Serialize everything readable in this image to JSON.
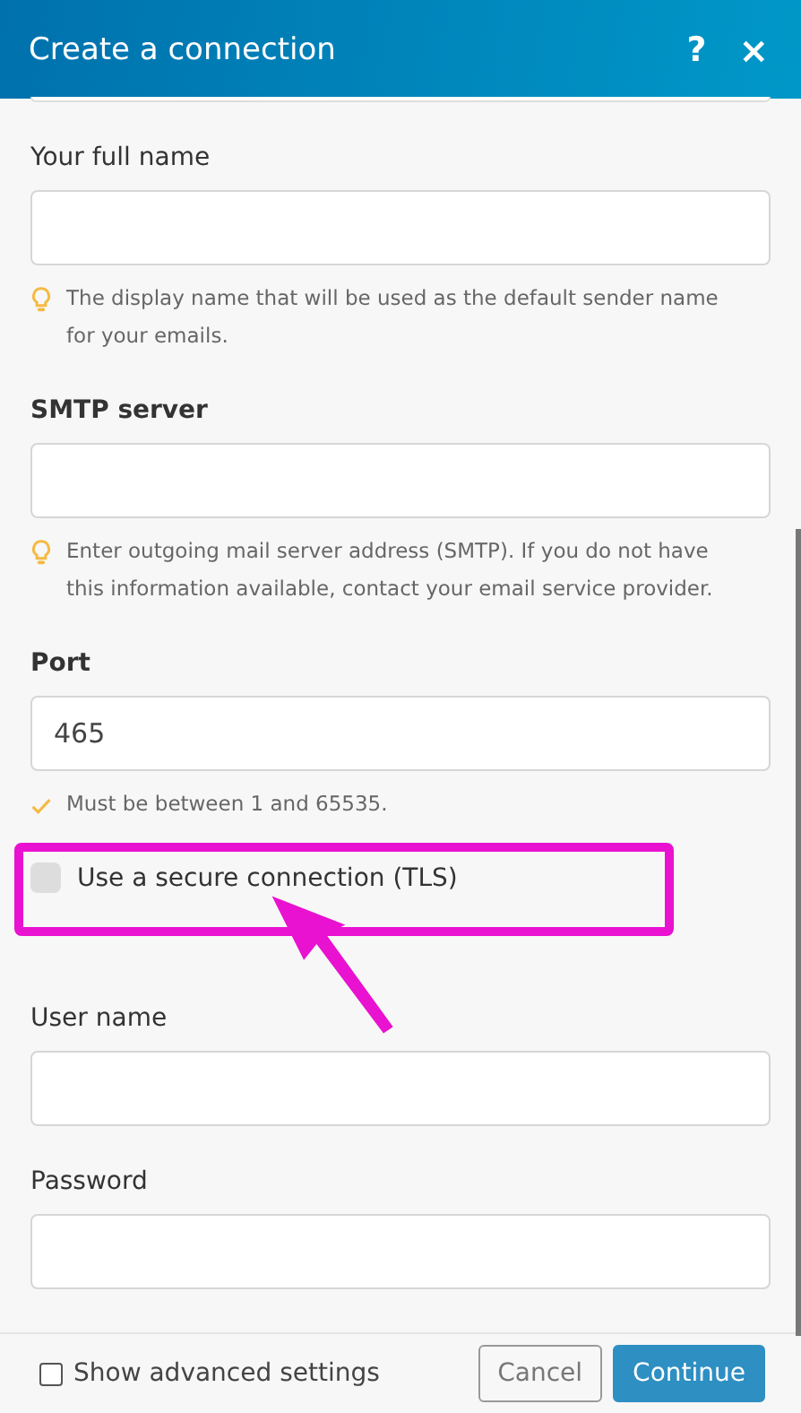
{
  "window": {
    "title": "Create a connection",
    "help": "?",
    "close": "×"
  },
  "fields": [
    {
      "kind": "text",
      "label": "Your full name",
      "required": false,
      "hint": {
        "kind": "tip",
        "text": "The display name that will be used as the default sender name for your emails."
      }
    },
    {
      "kind": "text",
      "label": "SMTP server",
      "required": true,
      "hint": {
        "kind": "tip",
        "text": "Enter outgoing mail server address (SMTP). If you do not have this information available, contact your email service provider."
      }
    },
    {
      "kind": "text",
      "label": "Port",
      "required": true,
      "value": "465",
      "hint": {
        "kind": "valid",
        "text": "Must be between 1 and 65535."
      }
    },
    {
      "kind": "checkbox",
      "label": "Use a secure connection (TLS)",
      "checked": false,
      "highlighted": true
    },
    {
      "kind": "text",
      "label": "User name",
      "required": false
    },
    {
      "kind": "password",
      "label": "Password",
      "required": false
    }
  ],
  "footer": {
    "advanced": {
      "label": "Show advanced settings",
      "checked": false
    },
    "buttons": [
      {
        "kind": "secondary",
        "label": "Cancel"
      },
      {
        "kind": "primary",
        "label": "Continue"
      }
    ]
  }
}
